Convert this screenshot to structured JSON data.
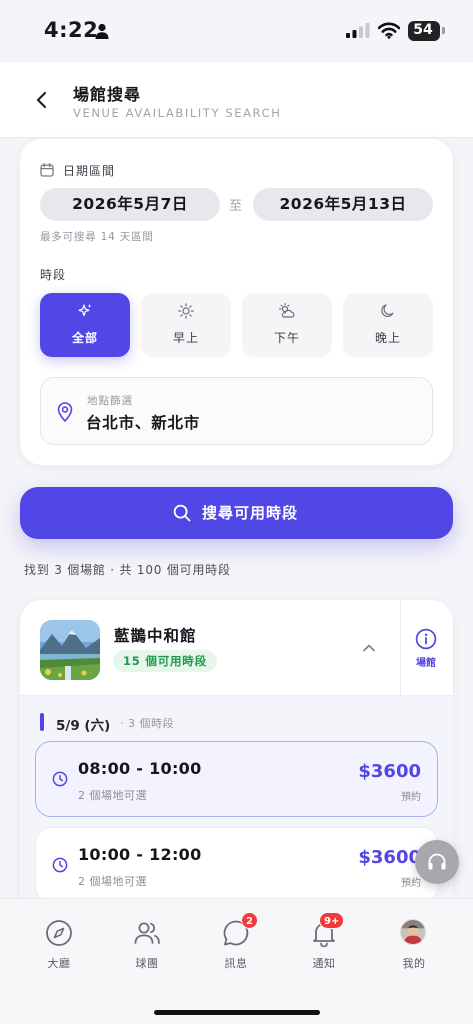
{
  "status_bar": {
    "time": "4:22",
    "battery": "54"
  },
  "header": {
    "title": "場館搜尋",
    "subtitle": "VENUE AVAILABILITY SEARCH"
  },
  "search": {
    "date_label": "日期區間",
    "start_date": "2026年5月7日",
    "separator": "至",
    "end_date": "2026年5月13日",
    "date_hint": "最多可搜尋 14 天區間",
    "period_label": "時段",
    "periods": [
      {
        "label": "全部",
        "icon": "sparkles-icon",
        "selected": true
      },
      {
        "label": "早上",
        "icon": "sun-icon",
        "selected": false
      },
      {
        "label": "下午",
        "icon": "cloud-sun-icon",
        "selected": false
      },
      {
        "label": "晚上",
        "icon": "moon-icon",
        "selected": false
      }
    ],
    "location_caption": "地點篩選",
    "location_value": "台北市、新北市",
    "button_label": "搜尋可用時段"
  },
  "results": {
    "summary": "找到 3 個場館 · 共 100 個可用時段",
    "venue": {
      "name": "藍鵲中和館",
      "slot_badge": "15 個可用時段",
      "info_label": "場館",
      "day": {
        "date": "5/9 (六)",
        "count": "· 3 個時段"
      },
      "slots": [
        {
          "time": "08:00 - 10:00",
          "courts": "2 個場地可選",
          "price": "$3600",
          "action": "預約"
        },
        {
          "time": "10:00 - 12:00",
          "courts": "2 個場地可選",
          "price": "$3600",
          "action": "預約"
        }
      ]
    }
  },
  "tabs": [
    {
      "label": "大廳",
      "icon": "compass-icon",
      "badge": ""
    },
    {
      "label": "球團",
      "icon": "users-icon",
      "badge": ""
    },
    {
      "label": "訊息",
      "icon": "chat-icon",
      "badge": "2"
    },
    {
      "label": "通知",
      "icon": "bell-icon",
      "badge": "9+"
    },
    {
      "label": "我的",
      "icon": "avatar",
      "badge": ""
    }
  ],
  "colors": {
    "accent": "#5146e6",
    "badge_red": "#ef3b3b",
    "success_green": "#1f9a4a"
  }
}
